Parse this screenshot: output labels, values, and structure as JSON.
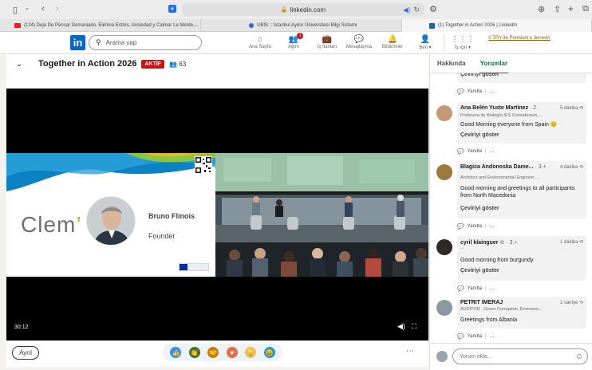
{
  "browser": {
    "url": "linkedin.com",
    "tabs": [
      {
        "label": "(124) Deja De Pensar Demasiado, Elimina Estrés, Ansiedad y Calmar La Mente,...",
        "color": "#e62117"
      },
      {
        "label": "UBIS :: İstanbul Aydın Üniversitesi Bilgi Sistemi",
        "color": "#4a5bd4"
      },
      {
        "label": "(1) Together in Action 2026 | LinkedIn",
        "color": "#0a66c2"
      }
    ]
  },
  "nav": {
    "search_placeholder": "Arama yap",
    "items": [
      {
        "label": "Ana Sayfa",
        "icon": "home-icon"
      },
      {
        "label": "Ağım",
        "icon": "network-icon",
        "badge": "1"
      },
      {
        "label": "İş İlanları",
        "icon": "jobs-icon"
      },
      {
        "label": "Mesajlaşma",
        "icon": "messaging-icon"
      },
      {
        "label": "Bildirimler",
        "icon": "bell-icon"
      },
      {
        "label": "Ben ▾",
        "icon": "me-avatar-icon"
      },
      {
        "label": "İş için ▾",
        "icon": "grid-icon"
      }
    ],
    "premium": "0 TRY ile Premium'u denevin"
  },
  "event": {
    "title": "Together in Action 2026",
    "live_label": "AKTİF",
    "viewers": "63",
    "follow_label": "Ayrıl"
  },
  "video": {
    "time": "30:12",
    "speaker_name": "Bruno Flinois",
    "speaker_role": "Founder",
    "brand_main": "Clem",
    "brand_accent": "’"
  },
  "right_panel": {
    "tabs": [
      "Hakkında",
      "Yorumlar"
    ],
    "translate_label": "Çeviriyi göster",
    "reply_label": "Yanıtla",
    "more_label": "…",
    "composer_placeholder": "Yorum ekle...",
    "comments": [
      {
        "name": "Ana Belén Yuste Martínez",
        "degree": "· 2.",
        "time": "5 dakika",
        "subtitle": "Profesora de Biología IES Consaburum,...",
        "text": "Good Morning everyone from Spain 😊"
      },
      {
        "name": "Blagica Andonoska Dame...",
        "degree": "· 3.+",
        "time": "4 dakika",
        "subtitle": "Architect and Environmental Engineer ...",
        "text": "Good morning and greetings to all participants from North Macedonia"
      },
      {
        "name": "cyril klainguer",
        "degree": "⊘ · 3.+",
        "time": "1 dakika",
        "subtitle": "...",
        "text": "Good morning from burgundy"
      },
      {
        "name": "PETRIT IMERAJ",
        "degree": "",
        "time": "1 saniye",
        "subtitle": "AUDITOR , Green Corruption, Environm...",
        "text": "Greetings from Albania"
      }
    ]
  },
  "colors": {
    "brand": "#0a66c2",
    "live": "#cc1016",
    "tab_active": "#01754f",
    "premium": "#915907"
  }
}
